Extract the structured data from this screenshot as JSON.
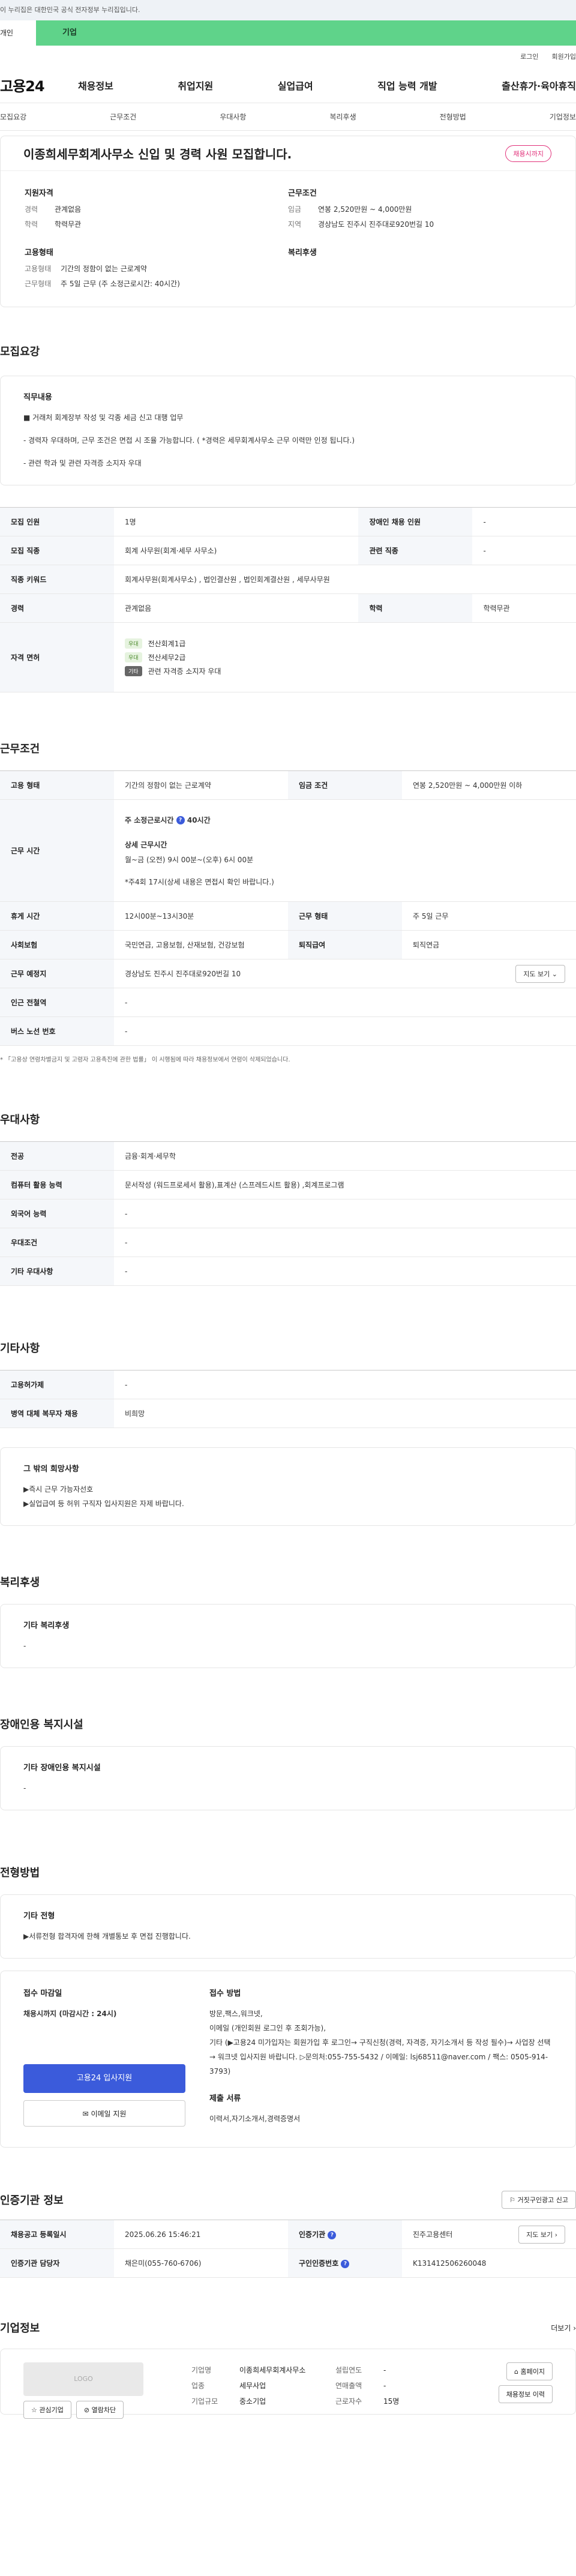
{
  "gov_banner": "이 누리집은 대한민국 공식 전자정부 누리집입니다.",
  "tabs": [
    "개인",
    "기업"
  ],
  "util": [
    "로그인",
    "회원가입"
  ],
  "logo": "고용24",
  "gnb": [
    "채용정보",
    "취업지원",
    "실업급여",
    "직업 능력 개발",
    "출산휴가·육아휴직"
  ],
  "snb": [
    "모집요강",
    "근무조건",
    "우대사항",
    "복리후생",
    "전형방법",
    "기업정보"
  ],
  "job": {
    "title": "이종희세무회계사무소 신입 및 경력 사원 모집합니다.",
    "badge": "채용시까지",
    "left_title": "지원자격",
    "career_k": "경력",
    "career_v": "관계없음",
    "edu_k": "학력",
    "edu_v": "학력무관",
    "right_title": "근무조건",
    "wage_k": "임금",
    "wage_v": "연봉 2,520만원 ~ 4,000만원",
    "loc_k": "지역",
    "loc_v": "경상남도 진주시 진주대로920번길 10",
    "emp_title": "고용형태",
    "emptype_k": "고용형태",
    "emptype_v": "기간의 정함이 없는 근로계약",
    "workform_k": "근무형태",
    "workform_v": "주 5일 근무 (주 소정근로시간: 40시간)",
    "welfare_title": "복리후생"
  },
  "recruit": {
    "title": "모집요강",
    "duty_h": "직무내용",
    "duty_1": "■ 거래처 회계장부 작성 및 각종 세금 신고 대행 업무",
    "duty_2": "- 경력자 우대하며, 근무 조건은 면접 시 조율 가능합니다. ( *경력은 세무회계사무소 근무 이력만 인정 됩니다.)",
    "duty_3": "- 관련 학과 및 관련 자격증 소지자 우대",
    "rows": [
      [
        "모집 인원",
        "1명",
        "장애인 채용 인원",
        "-"
      ],
      [
        "모집 직종",
        "회계 사무원(회계·세무 사무소)",
        "관련 직종",
        "-"
      ],
      [
        "직종 키워드",
        "회계사무원(회계사무소) , 법인결산원 , 법인회계결산원 , 세무사무원",
        "",
        ""
      ],
      [
        "경력",
        "관계없음",
        "학력",
        "학력무관"
      ]
    ],
    "lic_k": "자격 면허",
    "lic": [
      {
        "chip": "우대",
        "name": "전산회계1급"
      },
      {
        "chip": "우대",
        "name": "전산세무2급"
      },
      {
        "chip": "기타",
        "name": "관련 자격증 소지자 우대"
      }
    ]
  },
  "cond": {
    "title": "근무조건",
    "emp_k": "고용 형태",
    "emp_v": "기간의 정함이 없는 근로계약",
    "wage_k": "임금 조건",
    "wage_v": "연봉 2,520만원 ~ 4,000만원 이하",
    "time_k": "근무 시간",
    "time_1": "주 소정근로시간",
    "time_1b": "40시간",
    "time_2": "상세 근무시간",
    "time_3": "월~금 (오전) 9시 00분~(오후) 6시 00분",
    "time_4": "*주4회 17시(상세 내용은 면접시 확인 바랍니다.)",
    "rest_k": "휴게 시간",
    "rest_v": "12시00분~13시30분",
    "form_k": "근무 형태",
    "form_v": "주 5일 근무",
    "ins_k": "사회보험",
    "ins_v": "국민연금, 고용보험, 산재보험, 건강보험",
    "ret_k": "퇴직급여",
    "ret_v": "퇴직연금",
    "place_k": "근무 예정지",
    "place_v": "경상남도 진주시 진주대로920번길 10",
    "map_btn": "지도 보기",
    "sub_k": "인근 전철역",
    "sub_v": "-",
    "bus_k": "버스 노선 번호",
    "bus_v": "-",
    "note": "* 「고용상 연령차별금지 및 고령자 고용촉진에 관한 법률」 이 시행됨에 따라 채용정보에서 연령이 삭제되었습니다."
  },
  "pref": {
    "title": "우대사항",
    "rows": [
      [
        "전공",
        "금융·회계·세무학"
      ],
      [
        "컴퓨터 활용 능력",
        "문서작성 (워드프로세서 활용),표계산 (스프레드시트 활용) ,회계프로그램"
      ],
      [
        "외국어 능력",
        "-"
      ],
      [
        "우대조건",
        "-"
      ],
      [
        "기타 우대사항",
        "-"
      ]
    ]
  },
  "etc": {
    "title": "기타사항",
    "rows": [
      [
        "고용허가제",
        "-"
      ],
      [
        "병역 대체 복무자 채용",
        "비희망"
      ]
    ],
    "hope_h": "그 밖의 희망사항",
    "hope_1": "▶즉시 근무 가능자선호",
    "hope_2": "▶실업급여 등 허위 구직자 입사지원은 자제 바랍니다."
  },
  "welfare": {
    "title": "복리후생",
    "h": "기타 복리후생",
    "v": "-"
  },
  "disab": {
    "title": "장애인용 복지시설",
    "h": "기타 장애인용 복지시설",
    "v": "-"
  },
  "process": {
    "title": "전형방법",
    "h": "기타 전형",
    "v": "▶서류전형 합격자에 한해 개별통보 후 면접 진행합니다.",
    "deadline_h": "접수 마감일",
    "deadline_v": "채용시까지 (마감시간 : 24시)",
    "apply_btn": "고용24 입사지원",
    "email_btn": "이메일 지원",
    "method_h": "접수 방법",
    "method_1": "방문,팩스,워크넷,",
    "method_2": "이메일 (개인회원 로그인 후 조회가능),",
    "method_3": "기타 (▶고용24 미가입자는 회원가입 후 로그인→ 구직신청(경력, 자격증, 자기소개서 등 작성 필수)→ 사업장 선택→ 워크넷 입사지원 바랍니다. ▷문의처:055-755-5432 / 이메일: lsj68511@naver.com / 팩스: 0505-914-3793)",
    "docs_h": "제출 서류",
    "docs_v": "이력서,자기소개서,경력증명서"
  },
  "agency": {
    "title": "인증기관 정보",
    "report_btn": "거짓구인광고 신고",
    "reg_k": "채용공고 등록일시",
    "reg_v": "2025.06.26 15:46:21",
    "org_k": "인증기관",
    "org_v": "진주고용센터",
    "map_btn": "지도 보기",
    "mgr_k": "인증기관 담당자",
    "mgr_v": "채은미(055-760-6706)",
    "no_k": "구인인증번호",
    "no_v": "K131412506260048"
  },
  "company": {
    "title": "기업정보",
    "more": "더보기",
    "logo": "LOGO",
    "fav_btn": "관심기업",
    "blk_btn": "열람차단",
    "name_k": "기업명",
    "name_v": "이종희세무회계사무소",
    "ind_k": "업종",
    "ind_v": "세무사업",
    "size_k": "기업규모",
    "size_v": "중소기업",
    "year_k": "설립연도",
    "year_v": "-",
    "sales_k": "연매출액",
    "sales_v": "-",
    "emp_k": "근로자수",
    "emp_v": "15명",
    "home_btn": "홈페이지",
    "hist_btn": "채용정보 이력"
  }
}
